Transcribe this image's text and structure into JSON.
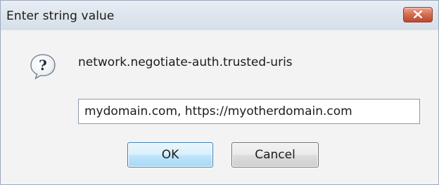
{
  "dialog": {
    "title": "Enter string value",
    "message": "network.negotiate-auth.trusted-uris",
    "input_value": "mydomain.com, https://myotherdomain.com",
    "ok_label": "OK",
    "cancel_label": "Cancel",
    "icon": "question-icon",
    "close_icon": "close-icon"
  },
  "colors": {
    "close_button": "#c4533a",
    "ok_border": "#3c7fb1",
    "titlebar": "#dfe6ee"
  }
}
